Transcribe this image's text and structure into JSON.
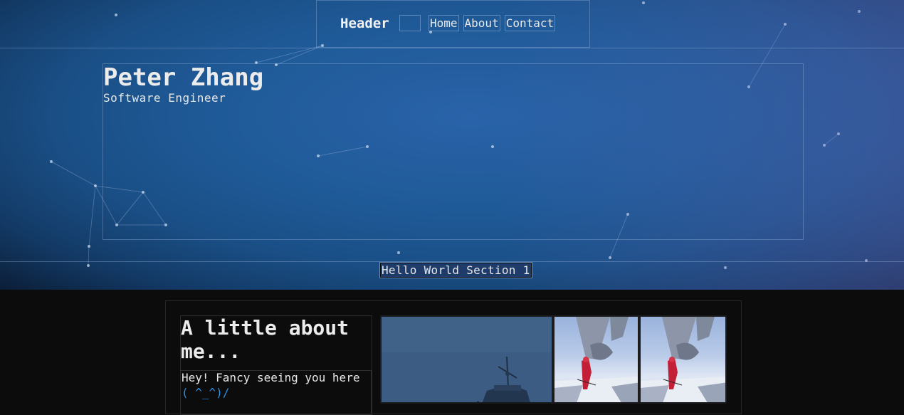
{
  "header": {
    "title": "Header",
    "nav": [
      {
        "label": "Home"
      },
      {
        "label": "About"
      },
      {
        "label": "Contact"
      }
    ]
  },
  "hero": {
    "name": "Peter Zhang",
    "role": "Software Engineer",
    "section_label": "Hello World Section 1"
  },
  "about": {
    "heading": "A little about me...",
    "greeting": "Hey! Fancy seeing you here",
    "emoticon": "( ^_^)/"
  },
  "colors": {
    "hero_blue": "#2a63a9",
    "page_dark": "#0c0c0c",
    "accent_link": "#2f8fe6"
  }
}
